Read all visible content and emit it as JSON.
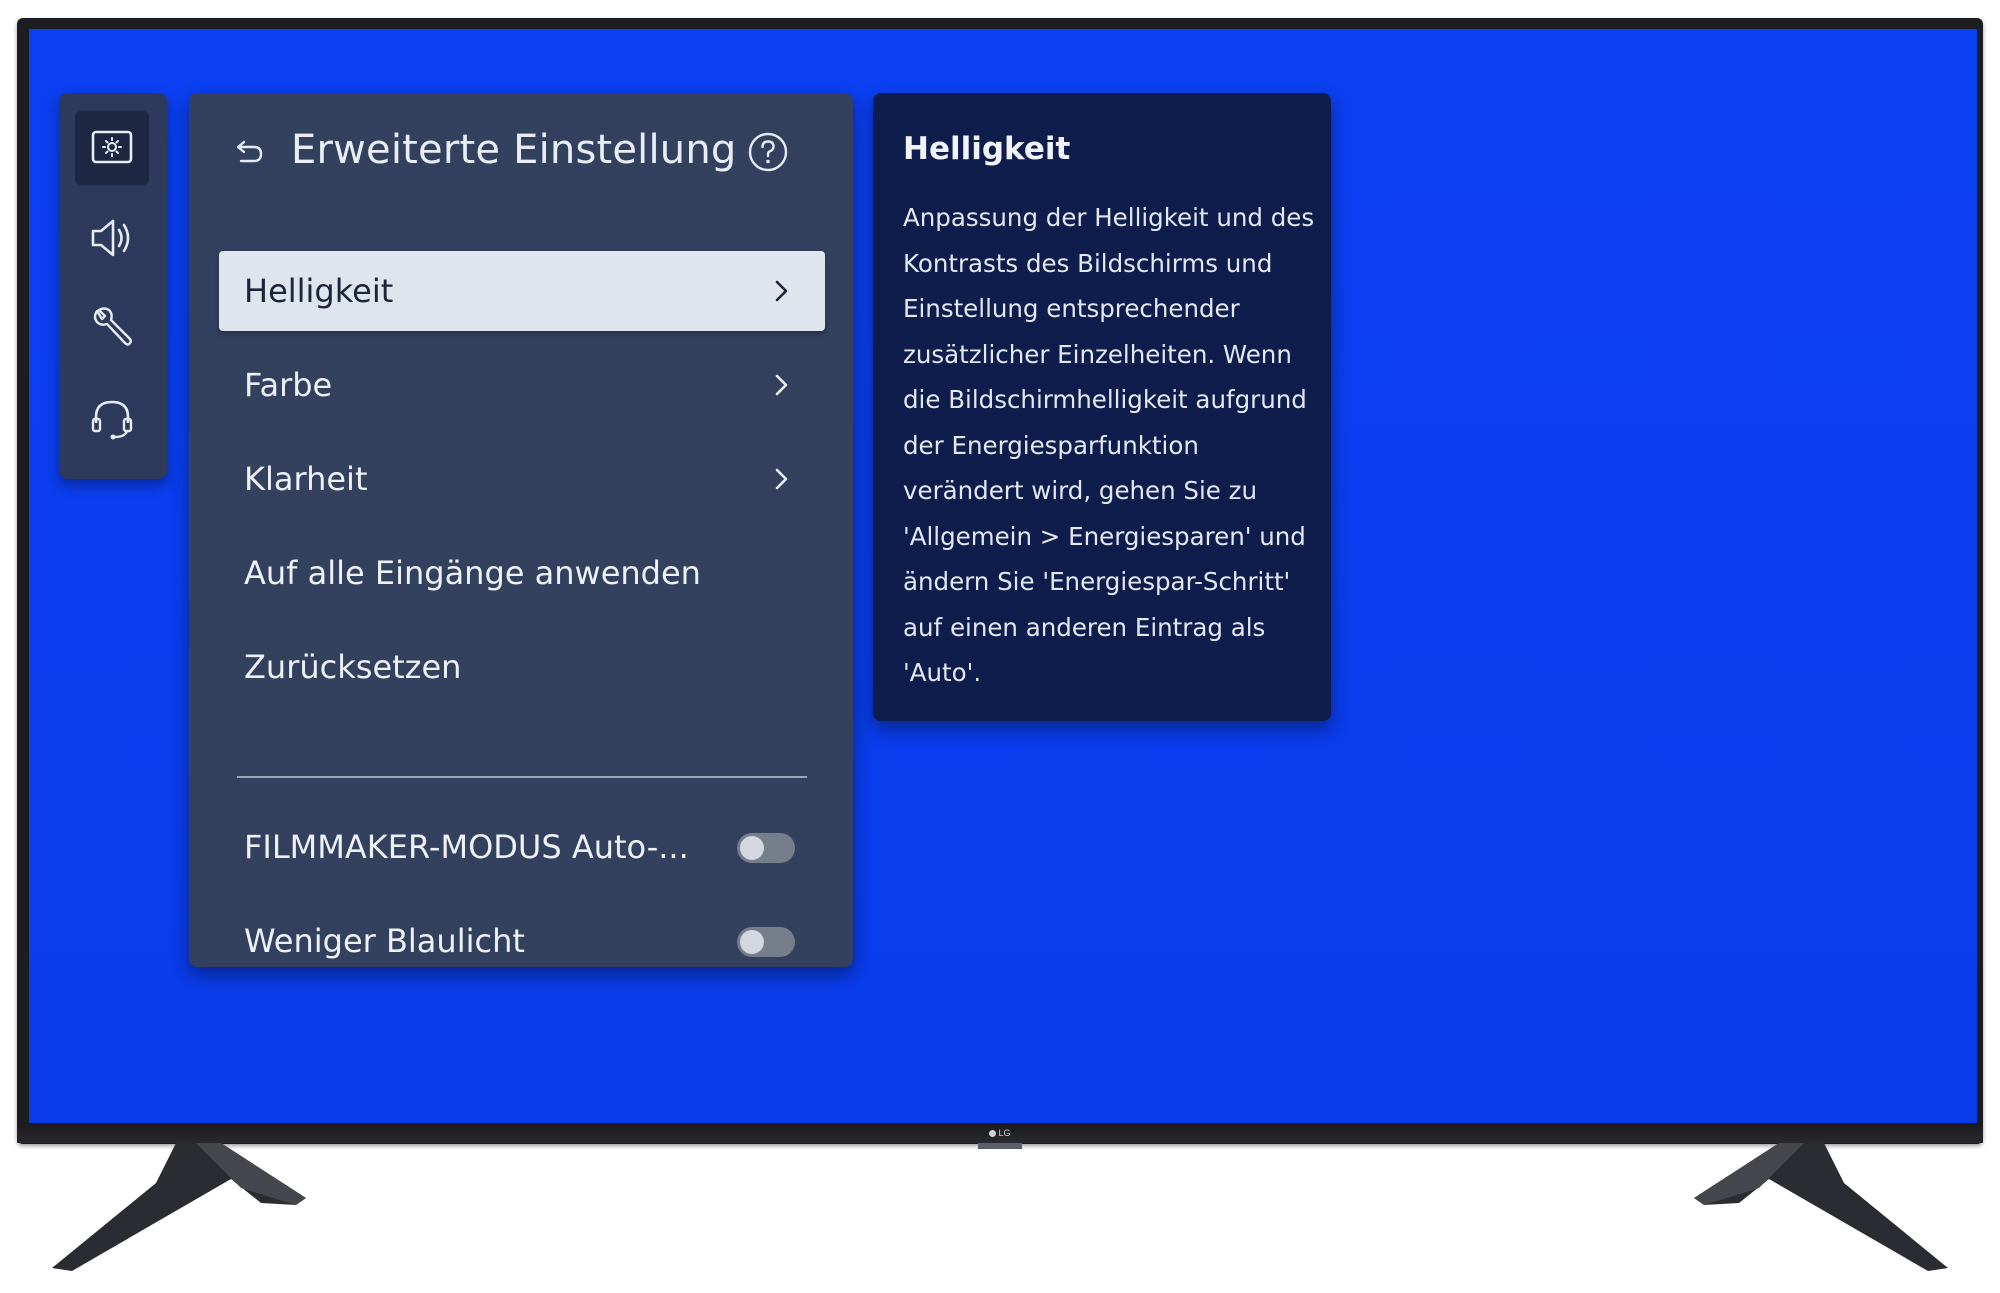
{
  "device": {
    "brand": "LG"
  },
  "icon_rail": {
    "items": [
      {
        "icon": "picture-icon",
        "active": true
      },
      {
        "icon": "speaker-icon",
        "active": false
      },
      {
        "icon": "wrench-icon",
        "active": false
      },
      {
        "icon": "headset-icon",
        "active": false
      }
    ]
  },
  "settings": {
    "title": "Erweiterte Einstellung",
    "items": [
      {
        "label": "Helligkeit",
        "chevron": true,
        "selected": true
      },
      {
        "label": "Farbe",
        "chevron": true
      },
      {
        "label": "Klarheit",
        "chevron": true
      },
      {
        "label": "Auf alle Eingänge anwenden"
      },
      {
        "label": "Zurücksetzen"
      }
    ],
    "toggles": [
      {
        "label": "FILMMAKER-MODUS Auto-...",
        "on": false
      },
      {
        "label": "Weniger Blaulicht",
        "on": false
      }
    ]
  },
  "info": {
    "title": "Helligkeit",
    "lines": [
      "Anpassung der Helligkeit und des",
      "Kontrasts des Bildschirms und",
      "Einstellung entsprechender",
      "zusätzlicher Einzelheiten. Wenn",
      "die Bildschirmhelligkeit aufgrund",
      "der Energiesparfunktion",
      "verändert wird, gehen Sie zu",
      "'Allgemein > Energiesparen' und",
      "ändern Sie 'Energiespar-Schritt'",
      "auf einen anderen Eintrag als",
      "'Auto'."
    ]
  },
  "colors": {
    "screen_background": "#0a3ff0",
    "panel": "#33415f",
    "info_panel": "#0f1d4d",
    "selected_item": "#dfe5ed"
  }
}
